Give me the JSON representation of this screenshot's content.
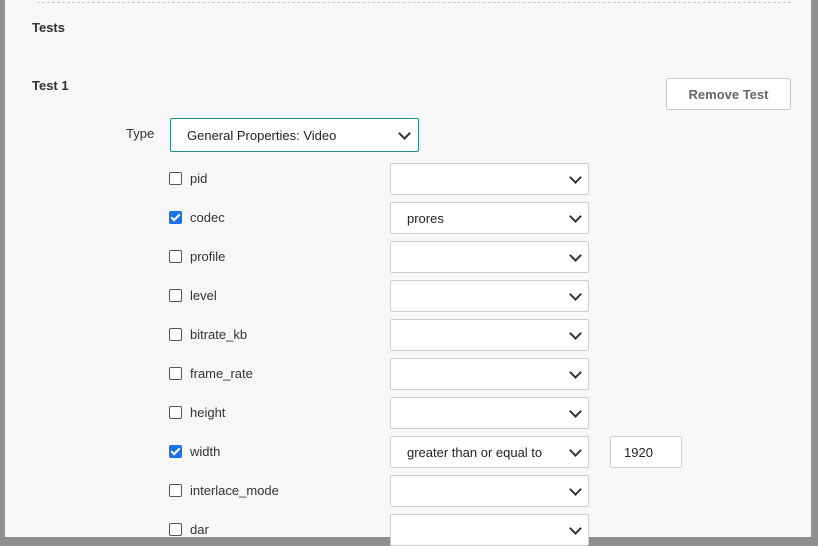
{
  "section": {
    "title": "Tests"
  },
  "test": {
    "title": "Test 1",
    "remove_label": "Remove Test",
    "type_label": "Type",
    "type_value": "General Properties: Video"
  },
  "fields": [
    {
      "name": "pid",
      "checked": false,
      "operator": "",
      "value": null
    },
    {
      "name": "codec",
      "checked": true,
      "operator": "prores",
      "value": null
    },
    {
      "name": "profile",
      "checked": false,
      "operator": "",
      "value": null
    },
    {
      "name": "level",
      "checked": false,
      "operator": "",
      "value": null
    },
    {
      "name": "bitrate_kb",
      "checked": false,
      "operator": "",
      "value": null
    },
    {
      "name": "frame_rate",
      "checked": false,
      "operator": "",
      "value": null
    },
    {
      "name": "height",
      "checked": false,
      "operator": "",
      "value": null
    },
    {
      "name": "width",
      "checked": true,
      "operator": "greater than or equal to",
      "value": "1920"
    },
    {
      "name": "interlace_mode",
      "checked": false,
      "operator": "",
      "value": null
    },
    {
      "name": "dar",
      "checked": false,
      "operator": "",
      "value": null
    }
  ],
  "colors": {
    "accent": "#1f8f86",
    "checkbox": "#1a73e8"
  },
  "icons": {
    "select": "chevron-down-icon",
    "checked": "checkmark-icon"
  }
}
